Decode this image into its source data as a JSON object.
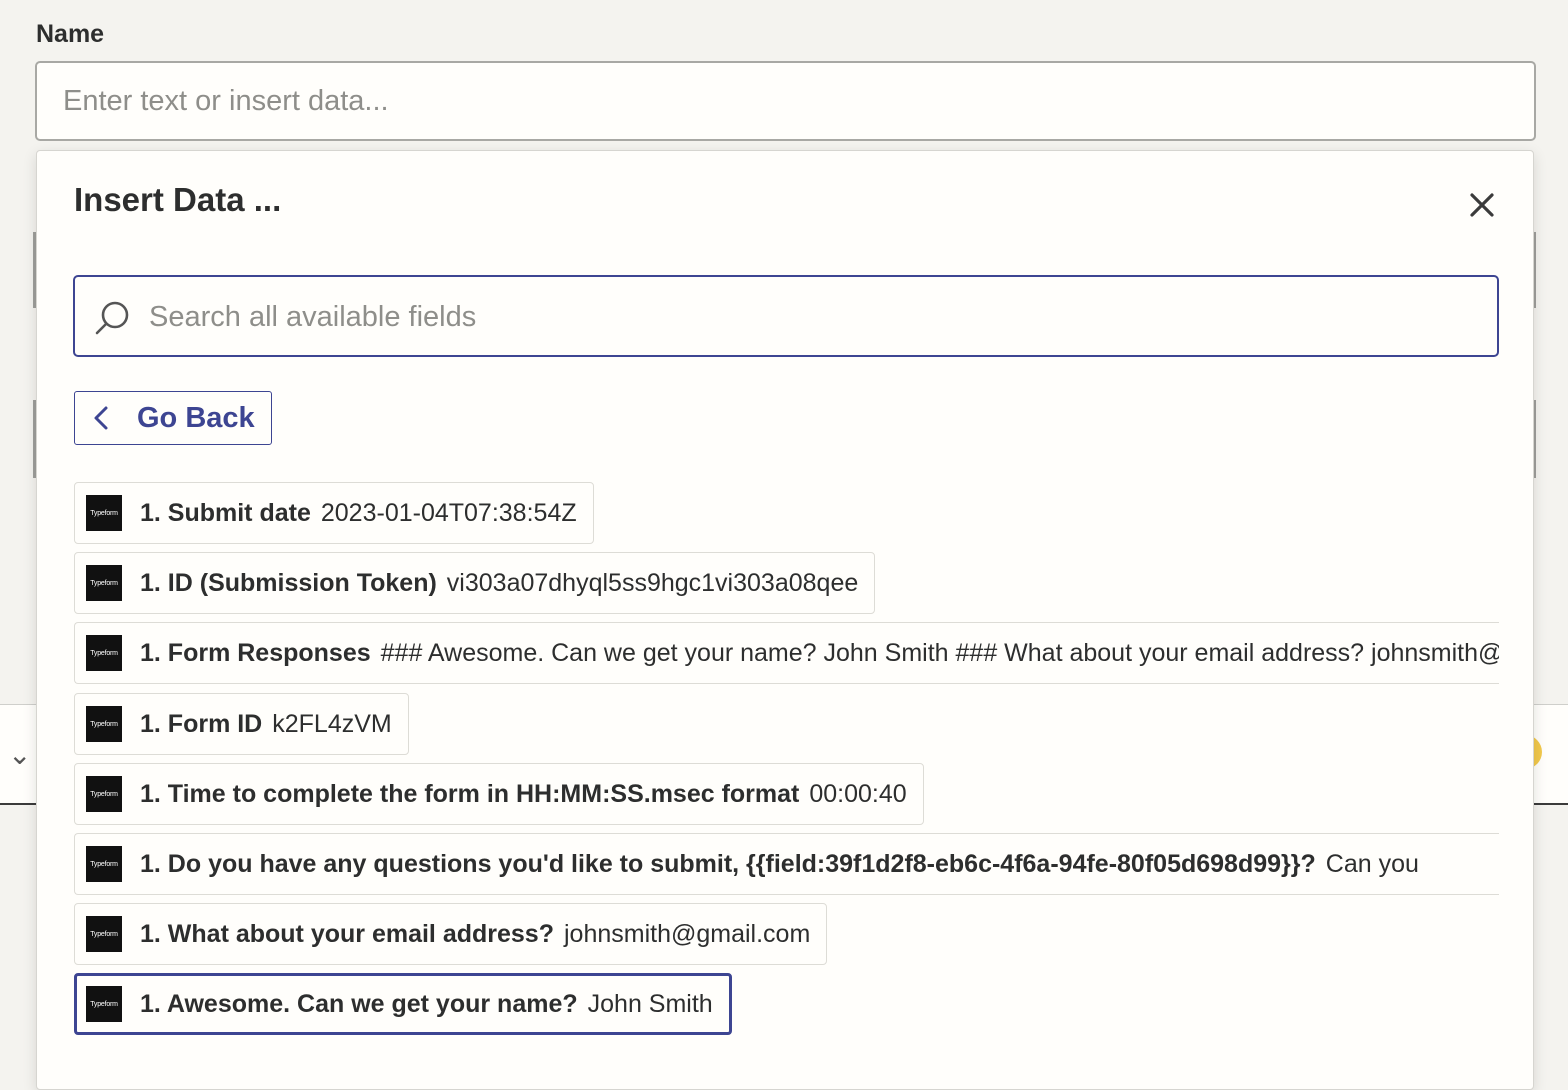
{
  "name_field": {
    "label": "Name",
    "placeholder": "Enter text or insert data..."
  },
  "popup": {
    "title": "Insert Data ...",
    "search_placeholder": "Search all available fields",
    "go_back_label": "Go Back",
    "app_logo_text": "Typeform",
    "items": [
      {
        "label": "1. Submit date",
        "value": "2023-01-04T07:38:54Z"
      },
      {
        "label": "1. ID (Submission Token)",
        "value": "vi303a07dhyql5ss9hgc1vi303a08qee"
      },
      {
        "label": "1. Form Responses",
        "value": "### Awesome. Can we get your name? John Smith ### What about your email address? johnsmith@gmail.com"
      },
      {
        "label": "1. Form ID",
        "value": "k2FL4zVM"
      },
      {
        "label": "1. Time to complete the form in HH:MM:SS.msec format",
        "value": "00:00:40"
      },
      {
        "label": "1. Do you have any questions you'd like to submit, {{field:39f1d2f8-eb6c-4f6a-94fe-80f05d698d99}}?",
        "value": "Can you"
      },
      {
        "label": "1. What about your email address?",
        "value": "johnsmith@gmail.com"
      },
      {
        "label": "1. Awesome. Can we get your name?",
        "value": "John Smith"
      }
    ]
  },
  "colors": {
    "accent": "#3d4592",
    "page_background": "#f4f3ef",
    "panel_background": "#fffefb"
  }
}
